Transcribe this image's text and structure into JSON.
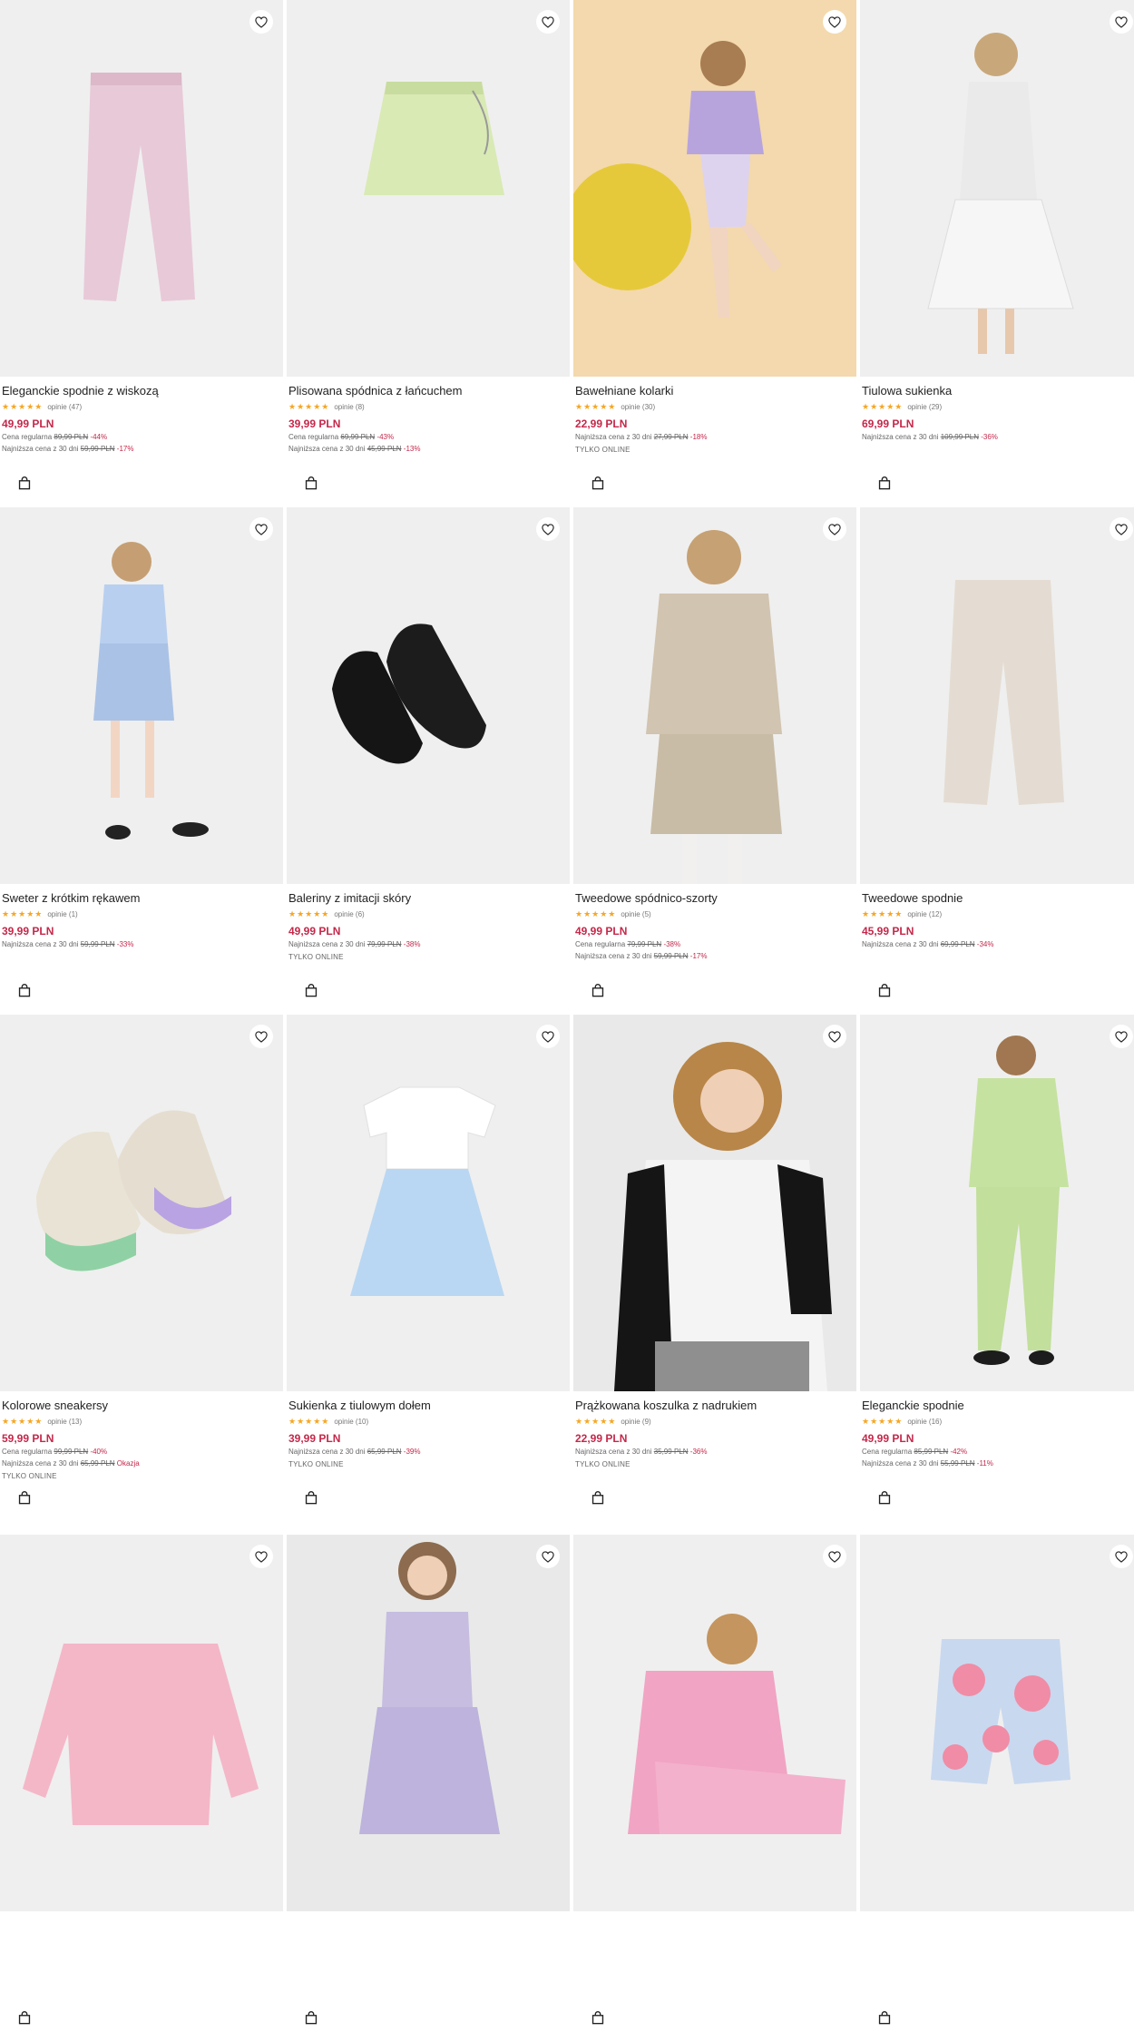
{
  "icons": {
    "wishlist": "heart-outline-icon",
    "cart": "shopping-bag-icon",
    "rating": "star-icon"
  },
  "colors": {
    "price_sale": "#c4284a",
    "star": "#f5a623",
    "image_bg": "#efefef"
  },
  "products": [
    {
      "name": "Eleganckie spodnie z wiskozą",
      "rating": 5,
      "reviews": "opinie (47)",
      "price": "49,99 PLN",
      "regular": {
        "label": "Cena regularna",
        "old": "89,99 PLN",
        "disc": "-44%"
      },
      "lowest": {
        "label": "Najniższa cena z 30 dni",
        "old": "59,99 PLN",
        "disc": "-17%"
      },
      "badge": ""
    },
    {
      "name": "Plisowana spódnica z łańcuchem",
      "rating": 5,
      "reviews": "opinie (8)",
      "price": "39,99 PLN",
      "regular": {
        "label": "Cena regularna",
        "old": "69,99 PLN",
        "disc": "-43%"
      },
      "lowest": {
        "label": "Najniższa cena z 30 dni",
        "old": "45,99 PLN",
        "disc": "-13%"
      },
      "badge": ""
    },
    {
      "name": "Bawełniane kolarki",
      "rating": 5,
      "reviews": "opinie (30)",
      "price": "22,99 PLN",
      "lowest": {
        "label": "Najniższa cena z 30 dni",
        "old": "27,99 PLN",
        "disc": "-18%"
      },
      "badge": "TYLKO ONLINE"
    },
    {
      "name": "Tiulowa sukienka",
      "rating": 5,
      "reviews": "opinie (29)",
      "price": "69,99 PLN",
      "lowest": {
        "label": "Najniższa cena z 30 dni",
        "old": "109,99 PLN",
        "disc": "-36%"
      },
      "badge": ""
    },
    {
      "name": "Sweter z krótkim rękawem",
      "rating": 5,
      "reviews": "opinie (1)",
      "price": "39,99 PLN",
      "lowest": {
        "label": "Najniższa cena z 30 dni",
        "old": "59,99 PLN",
        "disc": "-33%"
      },
      "badge": ""
    },
    {
      "name": "Baleriny z imitacji skóry",
      "rating": 4.5,
      "reviews": "opinie (6)",
      "price": "49,99 PLN",
      "lowest": {
        "label": "Najniższa cena z 30 dni",
        "old": "79,99 PLN",
        "disc": "-38%"
      },
      "badge": "TYLKO ONLINE"
    },
    {
      "name": "Tweedowe spódnico-szorty",
      "rating": 4.5,
      "reviews": "opinie (5)",
      "price": "49,99 PLN",
      "regular": {
        "label": "Cena regularna",
        "old": "79,99 PLN",
        "disc": "-38%"
      },
      "lowest": {
        "label": "Najniższa cena z 30 dni",
        "old": "59,99 PLN",
        "disc": "-17%"
      },
      "badge": ""
    },
    {
      "name": "Tweedowe spodnie",
      "rating": 5,
      "reviews": "opinie (12)",
      "price": "45,99 PLN",
      "lowest": {
        "label": "Najniższa cena z 30 dni",
        "old": "69,99 PLN",
        "disc": "-34%"
      },
      "badge": ""
    },
    {
      "name": "Kolorowe sneakersy",
      "rating": 5,
      "reviews": "opinie (13)",
      "price": "59,99 PLN",
      "regular": {
        "label": "Cena regularna",
        "old": "99,99 PLN",
        "disc": "-40%"
      },
      "lowest": {
        "label": "Najniższa cena z 30 dni",
        "old": "65,99 PLN",
        "disc": "Okazja"
      },
      "badge": "TYLKO ONLINE"
    },
    {
      "name": "Sukienka z tiulowym dołem",
      "rating": 5,
      "reviews": "opinie (10)",
      "price": "39,99 PLN",
      "lowest": {
        "label": "Najniższa cena z 30 dni",
        "old": "65,99 PLN",
        "disc": "-39%"
      },
      "badge": "TYLKO ONLINE"
    },
    {
      "name": "Prążkowana koszulka z nadrukiem",
      "rating": 5,
      "reviews": "opinie (9)",
      "price": "22,99 PLN",
      "lowest": {
        "label": "Najniższa cena z 30 dni",
        "old": "35,99 PLN",
        "disc": "-36%"
      },
      "badge": "TYLKO ONLINE"
    },
    {
      "name": "Eleganckie spodnie",
      "rating": 5,
      "reviews": "opinie (16)",
      "price": "49,99 PLN",
      "regular": {
        "label": "Cena regularna",
        "old": "85,99 PLN",
        "disc": "-42%"
      },
      "lowest": {
        "label": "Najniższa cena z 30 dni",
        "old": "55,99 PLN",
        "disc": "-11%"
      },
      "badge": ""
    },
    {
      "name": "",
      "rating": 0,
      "reviews": "",
      "price": "",
      "badge": ""
    },
    {
      "name": "",
      "rating": 0,
      "reviews": "",
      "price": "",
      "badge": ""
    },
    {
      "name": "",
      "rating": 0,
      "reviews": "",
      "price": "",
      "badge": ""
    },
    {
      "name": "",
      "rating": 0,
      "reviews": "",
      "price": "",
      "badge": ""
    }
  ]
}
